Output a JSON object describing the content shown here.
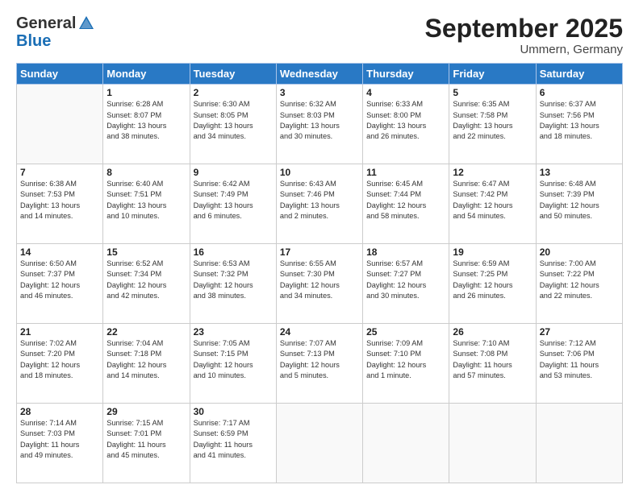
{
  "logo": {
    "general": "General",
    "blue": "Blue"
  },
  "header": {
    "month": "September 2025",
    "location": "Ummern, Germany"
  },
  "days_of_week": [
    "Sunday",
    "Monday",
    "Tuesday",
    "Wednesday",
    "Thursday",
    "Friday",
    "Saturday"
  ],
  "weeks": [
    [
      {
        "day": "",
        "info": ""
      },
      {
        "day": "1",
        "info": "Sunrise: 6:28 AM\nSunset: 8:07 PM\nDaylight: 13 hours\nand 38 minutes."
      },
      {
        "day": "2",
        "info": "Sunrise: 6:30 AM\nSunset: 8:05 PM\nDaylight: 13 hours\nand 34 minutes."
      },
      {
        "day": "3",
        "info": "Sunrise: 6:32 AM\nSunset: 8:03 PM\nDaylight: 13 hours\nand 30 minutes."
      },
      {
        "day": "4",
        "info": "Sunrise: 6:33 AM\nSunset: 8:00 PM\nDaylight: 13 hours\nand 26 minutes."
      },
      {
        "day": "5",
        "info": "Sunrise: 6:35 AM\nSunset: 7:58 PM\nDaylight: 13 hours\nand 22 minutes."
      },
      {
        "day": "6",
        "info": "Sunrise: 6:37 AM\nSunset: 7:56 PM\nDaylight: 13 hours\nand 18 minutes."
      }
    ],
    [
      {
        "day": "7",
        "info": "Sunrise: 6:38 AM\nSunset: 7:53 PM\nDaylight: 13 hours\nand 14 minutes."
      },
      {
        "day": "8",
        "info": "Sunrise: 6:40 AM\nSunset: 7:51 PM\nDaylight: 13 hours\nand 10 minutes."
      },
      {
        "day": "9",
        "info": "Sunrise: 6:42 AM\nSunset: 7:49 PM\nDaylight: 13 hours\nand 6 minutes."
      },
      {
        "day": "10",
        "info": "Sunrise: 6:43 AM\nSunset: 7:46 PM\nDaylight: 13 hours\nand 2 minutes."
      },
      {
        "day": "11",
        "info": "Sunrise: 6:45 AM\nSunset: 7:44 PM\nDaylight: 12 hours\nand 58 minutes."
      },
      {
        "day": "12",
        "info": "Sunrise: 6:47 AM\nSunset: 7:42 PM\nDaylight: 12 hours\nand 54 minutes."
      },
      {
        "day": "13",
        "info": "Sunrise: 6:48 AM\nSunset: 7:39 PM\nDaylight: 12 hours\nand 50 minutes."
      }
    ],
    [
      {
        "day": "14",
        "info": "Sunrise: 6:50 AM\nSunset: 7:37 PM\nDaylight: 12 hours\nand 46 minutes."
      },
      {
        "day": "15",
        "info": "Sunrise: 6:52 AM\nSunset: 7:34 PM\nDaylight: 12 hours\nand 42 minutes."
      },
      {
        "day": "16",
        "info": "Sunrise: 6:53 AM\nSunset: 7:32 PM\nDaylight: 12 hours\nand 38 minutes."
      },
      {
        "day": "17",
        "info": "Sunrise: 6:55 AM\nSunset: 7:30 PM\nDaylight: 12 hours\nand 34 minutes."
      },
      {
        "day": "18",
        "info": "Sunrise: 6:57 AM\nSunset: 7:27 PM\nDaylight: 12 hours\nand 30 minutes."
      },
      {
        "day": "19",
        "info": "Sunrise: 6:59 AM\nSunset: 7:25 PM\nDaylight: 12 hours\nand 26 minutes."
      },
      {
        "day": "20",
        "info": "Sunrise: 7:00 AM\nSunset: 7:22 PM\nDaylight: 12 hours\nand 22 minutes."
      }
    ],
    [
      {
        "day": "21",
        "info": "Sunrise: 7:02 AM\nSunset: 7:20 PM\nDaylight: 12 hours\nand 18 minutes."
      },
      {
        "day": "22",
        "info": "Sunrise: 7:04 AM\nSunset: 7:18 PM\nDaylight: 12 hours\nand 14 minutes."
      },
      {
        "day": "23",
        "info": "Sunrise: 7:05 AM\nSunset: 7:15 PM\nDaylight: 12 hours\nand 10 minutes."
      },
      {
        "day": "24",
        "info": "Sunrise: 7:07 AM\nSunset: 7:13 PM\nDaylight: 12 hours\nand 5 minutes."
      },
      {
        "day": "25",
        "info": "Sunrise: 7:09 AM\nSunset: 7:10 PM\nDaylight: 12 hours\nand 1 minute."
      },
      {
        "day": "26",
        "info": "Sunrise: 7:10 AM\nSunset: 7:08 PM\nDaylight: 11 hours\nand 57 minutes."
      },
      {
        "day": "27",
        "info": "Sunrise: 7:12 AM\nSunset: 7:06 PM\nDaylight: 11 hours\nand 53 minutes."
      }
    ],
    [
      {
        "day": "28",
        "info": "Sunrise: 7:14 AM\nSunset: 7:03 PM\nDaylight: 11 hours\nand 49 minutes."
      },
      {
        "day": "29",
        "info": "Sunrise: 7:15 AM\nSunset: 7:01 PM\nDaylight: 11 hours\nand 45 minutes."
      },
      {
        "day": "30",
        "info": "Sunrise: 7:17 AM\nSunset: 6:59 PM\nDaylight: 11 hours\nand 41 minutes."
      },
      {
        "day": "",
        "info": ""
      },
      {
        "day": "",
        "info": ""
      },
      {
        "day": "",
        "info": ""
      },
      {
        "day": "",
        "info": ""
      }
    ]
  ]
}
